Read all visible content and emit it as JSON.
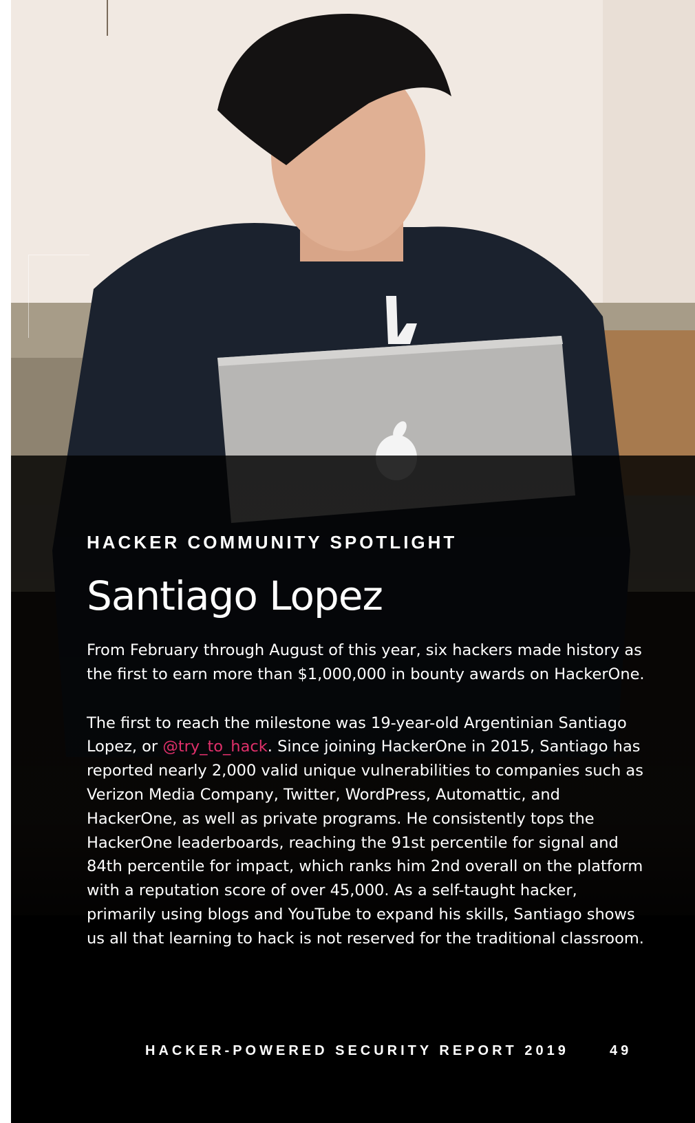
{
  "spotlight": {
    "eyebrow": "HACKER COMMUNITY SPOTLIGHT",
    "name": "Santiago Lopez",
    "paragraph1": "From February through August of this year, six hackers made history as the first to earn more than $1,000,000 in bounty awards on HackerOne.",
    "paragraph2_before": "The first to reach the milestone was 19-year-old Argentinian Santiago Lopez, or ",
    "handle": "@try_to_hack",
    "paragraph2_after": ". Since joining HackerOne in 2015, Santiago has reported nearly 2,000 valid unique vulnerabilities to companies such as Verizon Media Company, Twitter, WordPress, Automattic, and HackerOne, as well as private programs. He consistently tops the HackerOne leaderboards, reaching the 91st percentile for signal and 84th percentile for impact, which ranks him 2nd overall on the platform with a reputation score of over 45,000. As a self-taught hacker, primarily using blogs and YouTube to expand his skills, Santiago shows us all that learning to hack is not reserved for the traditional classroom."
  },
  "footer": {
    "report_title": "HACKER-POWERED SECURITY REPORT 2019",
    "page_number": "49"
  },
  "colors": {
    "handle_accent": "#e0306a",
    "background": "#000000",
    "text": "#ffffff"
  }
}
